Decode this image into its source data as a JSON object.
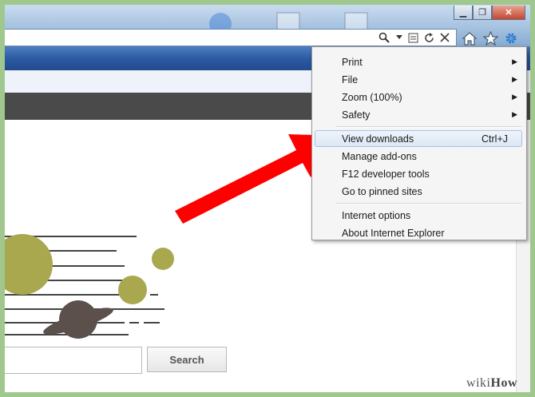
{
  "window": {
    "minimize_glyph": "▁",
    "maximize_glyph": "❐",
    "close_glyph": "✕"
  },
  "address_bar": {
    "search_icon": "search-icon",
    "dropdown_icon": "chevron-down-icon",
    "compat_icon": "compatibility-view-icon",
    "refresh_icon": "refresh-icon",
    "stop_icon": "stop-icon"
  },
  "toolbar": {
    "home_icon": "home-icon",
    "favorites_icon": "star-icon",
    "tools_icon": "gear-icon"
  },
  "menu": {
    "items": [
      {
        "label": "Print",
        "submenu": true
      },
      {
        "label": "File",
        "submenu": true
      },
      {
        "label": "Zoom (100%)",
        "submenu": true
      },
      {
        "label": "Safety",
        "submenu": true
      },
      {
        "label": "View downloads",
        "shortcut": "Ctrl+J",
        "highlighted": true
      },
      {
        "label": "Manage add-ons"
      },
      {
        "label": "F12 developer tools"
      },
      {
        "label": "Go to pinned sites"
      },
      {
        "label": "Internet options"
      },
      {
        "label": "About Internet Explorer"
      }
    ],
    "chevron": "▶"
  },
  "page": {
    "search_button_label": "Search",
    "search_value": ""
  },
  "watermark": {
    "part1": "wiki",
    "part2": "How"
  },
  "colors": {
    "border_green": "#9fc78e",
    "arrow_red": "#ff0000",
    "planet_olive": "#a9a84f",
    "planet_dark": "#5b504c",
    "dark_bar": "#4a4a4a"
  }
}
